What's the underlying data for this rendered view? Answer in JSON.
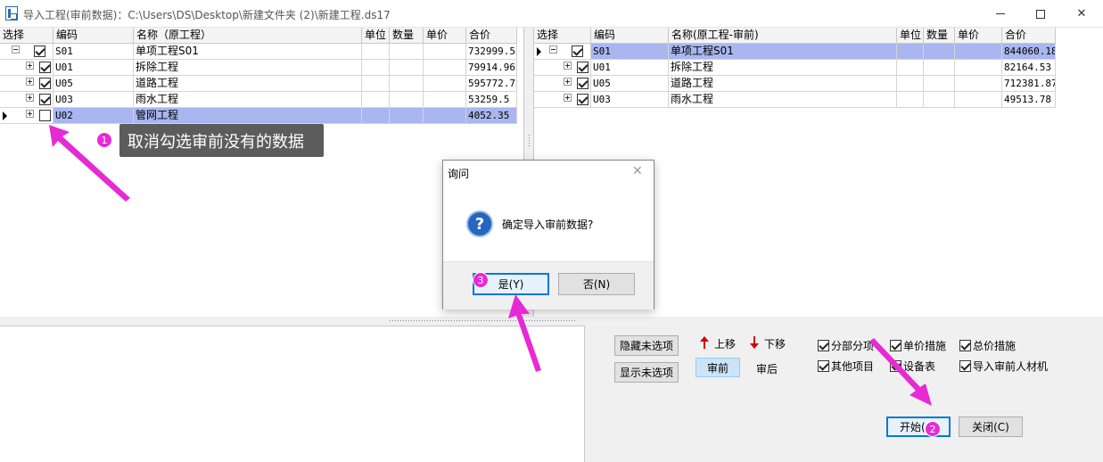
{
  "window": {
    "title": "导入工程(审前数据)：C:\\Users\\DS\\Desktop\\新建文件夹 (2)\\新建工程.ds17"
  },
  "left_grid": {
    "headers": [
      "选择",
      "编码",
      "名称（原工程）",
      "单位",
      "数量",
      "单价",
      "合价"
    ],
    "rows": [
      {
        "code": "S01",
        "name": "单项工程S01",
        "total": "732999.53",
        "checked": true,
        "level": 0
      },
      {
        "code": "U01",
        "name": "拆除工程",
        "total": "79914.96",
        "checked": true,
        "level": 1
      },
      {
        "code": "U05",
        "name": "道路工程",
        "total": "595772.72",
        "checked": true,
        "level": 1
      },
      {
        "code": "U03",
        "name": "雨水工程",
        "total": "53259.5",
        "checked": true,
        "level": 1
      },
      {
        "code": "U02",
        "name": "管网工程",
        "total": "4052.35",
        "checked": false,
        "level": 1,
        "selected": true
      }
    ]
  },
  "right_grid": {
    "headers": [
      "选择",
      "编码",
      "名称(原工程-审前)",
      "单位",
      "数量",
      "单价",
      "合价"
    ],
    "rows": [
      {
        "code": "S01",
        "name": "单项工程S01",
        "total": "844060.18",
        "checked": true,
        "level": 0,
        "selected": true
      },
      {
        "code": "U01",
        "name": "拆除工程",
        "total": "82164.53",
        "checked": true,
        "level": 1
      },
      {
        "code": "U05",
        "name": "道路工程",
        "total": "712381.87",
        "checked": true,
        "level": 1
      },
      {
        "code": "U03",
        "name": "雨水工程",
        "total": "49513.78",
        "checked": true,
        "level": 1
      }
    ]
  },
  "bottom": {
    "hide_unselected": "隐藏未选项",
    "show_unselected": "显示未选项",
    "move_up": "上移",
    "move_down": "下移",
    "before_review": "审前",
    "after_review": "审后",
    "options": [
      {
        "label": "分部分项",
        "checked": true
      },
      {
        "label": "单价措施",
        "checked": true
      },
      {
        "label": "总价措施",
        "checked": true
      },
      {
        "label": "其他项目",
        "checked": true
      },
      {
        "label": "设备表",
        "checked": true
      },
      {
        "label": "导入审前人材机",
        "checked": true
      }
    ],
    "start_button": "开始(",
    "close_button": "关闭(C)"
  },
  "dialog": {
    "title": "询问",
    "message": "确定导入审前数据?",
    "yes": "是(Y)",
    "no": "否(N)"
  },
  "annotations": {
    "callout_text": "取消勾选审前没有的数据",
    "badge1": "1",
    "badge2": "2",
    "badge3": "3",
    "arrow_color": "#e62ad5"
  }
}
